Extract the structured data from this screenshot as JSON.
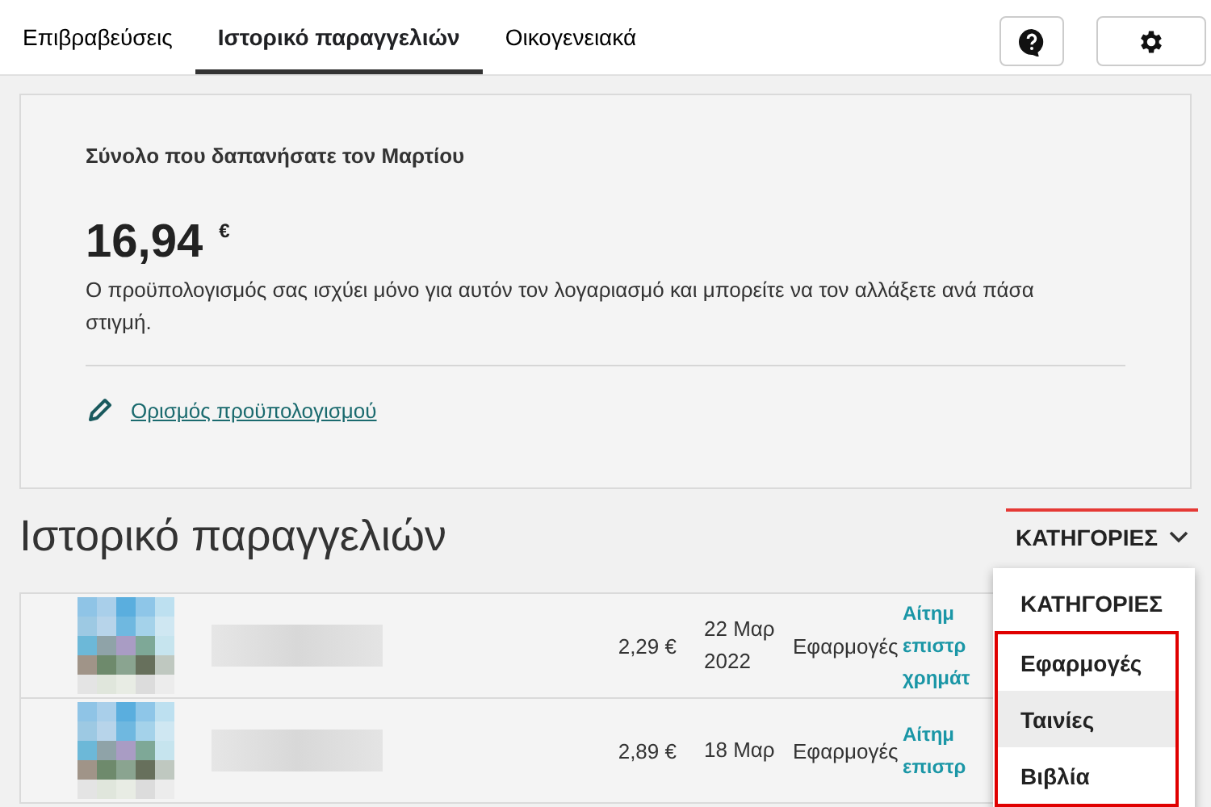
{
  "tabs": [
    {
      "label": "Επιβραβεύσεις",
      "selected": false
    },
    {
      "label": "Ιστορικό παραγγελιών",
      "selected": true
    },
    {
      "label": "Οικογενειακά",
      "selected": false
    }
  ],
  "budget": {
    "title": "Σύνολο που δαπανήσατε τον Μαρτίου",
    "amount": "16,94",
    "currency": "€",
    "note": "Ο προϋπολογισμός σας ισχύει μόνο για αυτόν τον λογαριασμό και μπορείτε να τον αλλάξετε ανά πάσα στιγμή.",
    "link": "Ορισμός προϋπολογισμού"
  },
  "history": {
    "title": "Ιστορικό παραγγελιών",
    "filter": "ΚΑΤΗΓΟΡΙΕΣ",
    "menu": [
      {
        "label": "ΚΑΤΗΓΟΡΙΕΣ",
        "selected": false,
        "highlighted": false
      },
      {
        "label": "Εφαρμογές",
        "selected": false,
        "highlighted": true
      },
      {
        "label": "Ταινίες",
        "selected": true,
        "highlighted": true
      },
      {
        "label": "Βιβλία",
        "selected": false,
        "highlighted": true
      }
    ],
    "rows": [
      {
        "price": "2,29 €",
        "date": [
          "22 Μαρ",
          "2022"
        ],
        "category": "Εφαρμογές",
        "action": [
          "Αίτημ",
          "επιστρ",
          "χρημάτ"
        ]
      },
      {
        "price": "2,89 €",
        "date": [
          "18 Μαρ"
        ],
        "category": "Εφαρμογές",
        "action": [
          "Αίτημ",
          "επιστρ"
        ]
      }
    ]
  }
}
